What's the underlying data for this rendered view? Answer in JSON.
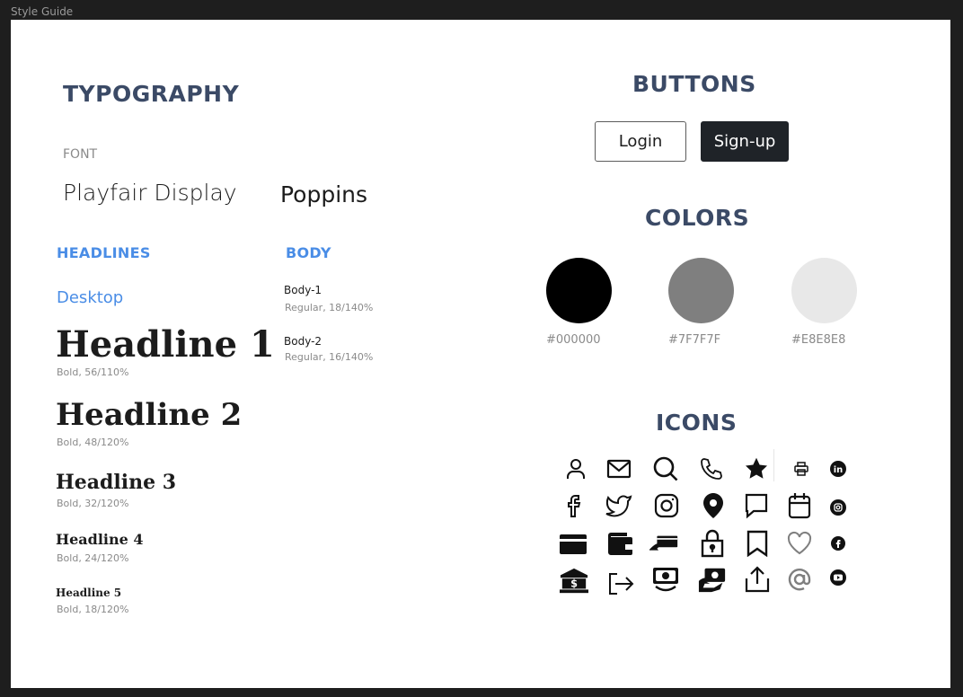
{
  "window": {
    "title": "Style Guide"
  },
  "typography": {
    "title": "TYPOGRAPHY",
    "font_label": "FONT",
    "fonts": [
      "Playfair Display",
      "Poppins"
    ],
    "headlines": {
      "title": "HEADLINES",
      "subtitle": "Desktop",
      "items": [
        {
          "label": "Headline 1",
          "spec": "Bold, 56/110%"
        },
        {
          "label": "Headline 2",
          "spec": "Bold, 48/120%"
        },
        {
          "label": "Headline 3",
          "spec": "Bold, 32/120%"
        },
        {
          "label": "Headline 4",
          "spec": "Bold, 24/120%"
        },
        {
          "label": "Headline 5",
          "spec": "Bold, 18/120%"
        }
      ]
    },
    "body": {
      "title": "BODY",
      "items": [
        {
          "label": "Body-1",
          "spec": "Regular, 18/140%"
        },
        {
          "label": "Body-2",
          "spec": "Regular, 16/140%"
        }
      ]
    }
  },
  "buttons": {
    "title": "BUTTONS",
    "login": "Login",
    "signup": "Sign-up"
  },
  "colors": {
    "title": "COLORS",
    "swatches": [
      {
        "hex": "#000000",
        "label": "#000000"
      },
      {
        "hex": "#7F7F7F",
        "label": "#7F7F7F"
      },
      {
        "hex": "#E8E8E8",
        "label": "#E8E8E8"
      }
    ]
  },
  "icons": {
    "title": "ICONS",
    "rows": [
      [
        "user-icon",
        "mail-icon",
        "search-icon",
        "phone-icon",
        "star-icon",
        "printer-icon",
        "linkedin-icon"
      ],
      [
        "facebook-icon",
        "twitter-icon",
        "instagram-icon",
        "location-pin-icon",
        "chat-bubble-icon",
        "calendar-icon",
        "instagram-small-icon"
      ],
      [
        "credit-card-icon",
        "wallet-icon",
        "card-payment-icon",
        "lock-icon",
        "bookmark-icon",
        "heart-icon",
        "facebook-small-icon"
      ],
      [
        "bank-icon",
        "logout-icon",
        "cash-icon",
        "money-hand-icon",
        "share-upload-icon",
        "at-sign-icon",
        "youtube-icon"
      ]
    ]
  }
}
